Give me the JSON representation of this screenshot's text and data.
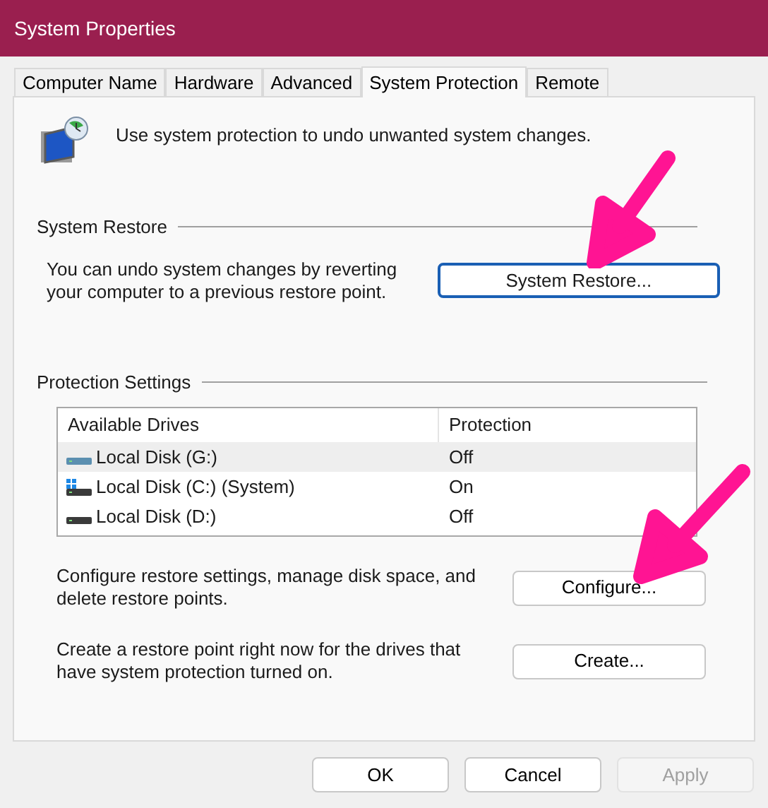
{
  "window": {
    "title": "System Properties"
  },
  "tabs": [
    {
      "label": "Computer Name",
      "selected": false
    },
    {
      "label": "Hardware",
      "selected": false
    },
    {
      "label": "Advanced",
      "selected": false
    },
    {
      "label": "System Protection",
      "selected": true
    },
    {
      "label": "Remote",
      "selected": false
    }
  ],
  "intro": "Use system protection to undo unwanted system changes.",
  "system_restore": {
    "heading": "System Restore",
    "text": "You can undo system changes by reverting your computer to a previous restore point.",
    "button": "System Restore..."
  },
  "protection_settings": {
    "heading": "Protection Settings",
    "columns": [
      "Available Drives",
      "Protection"
    ],
    "rows": [
      {
        "kind": "drive",
        "name": "Local Disk (G:)",
        "protection": "Off",
        "selected": true
      },
      {
        "kind": "system",
        "name": "Local Disk (C:) (System)",
        "protection": "On",
        "selected": false
      },
      {
        "kind": "drive-dark",
        "name": "Local Disk (D:)",
        "protection": "Off",
        "selected": false
      }
    ],
    "configure_text": "Configure restore settings, manage disk space, and delete restore points.",
    "configure_button": "Configure...",
    "create_text": "Create a restore point right now for the drives that have system protection turned on.",
    "create_button": "Create..."
  },
  "buttons": [
    {
      "label": "OK",
      "disabled": false
    },
    {
      "label": "Cancel",
      "disabled": false
    },
    {
      "label": "Apply",
      "disabled": true
    }
  ]
}
